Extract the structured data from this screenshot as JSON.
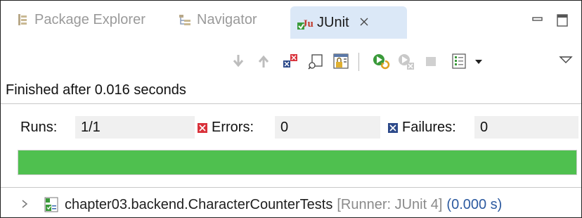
{
  "tabs": [
    {
      "label": "Package Explorer",
      "icon": "package-explorer-icon",
      "active": false
    },
    {
      "label": "Navigator",
      "icon": "navigator-icon",
      "active": false
    },
    {
      "label": "JUnit",
      "icon": "junit-icon",
      "active": true,
      "close": "✕"
    }
  ],
  "toolbar": {
    "icons": [
      "next-failure-icon",
      "previous-failure-icon",
      "show-failures-only-icon",
      "scroll-lock-icon",
      "lock-icon",
      "rerun-icon",
      "rerun-failed-first-icon",
      "stop-icon",
      "history-icon",
      "history-dropdown-icon",
      "view-menu-icon"
    ]
  },
  "status": "Finished after 0.016 seconds",
  "counters": {
    "runs_label": "Runs:",
    "runs_value": "1/1",
    "errors_label": "Errors:",
    "errors_value": "0",
    "failures_label": "Failures:",
    "failures_value": "0"
  },
  "progress": {
    "fraction": 1.0,
    "color": "#4fc04f"
  },
  "tree": {
    "test_class": "chapter03.backend.CharacterCounterTests",
    "runner": "[Runner: JUnit 4]",
    "time": "(0.000 s)"
  },
  "colors": {
    "active_tab_bg": "#dbe8f7",
    "error_red": "#d9323b",
    "failure_blue": "#2d4a8a",
    "time_blue": "#2c5aa0",
    "runner_gray": "#8a8a8a"
  }
}
